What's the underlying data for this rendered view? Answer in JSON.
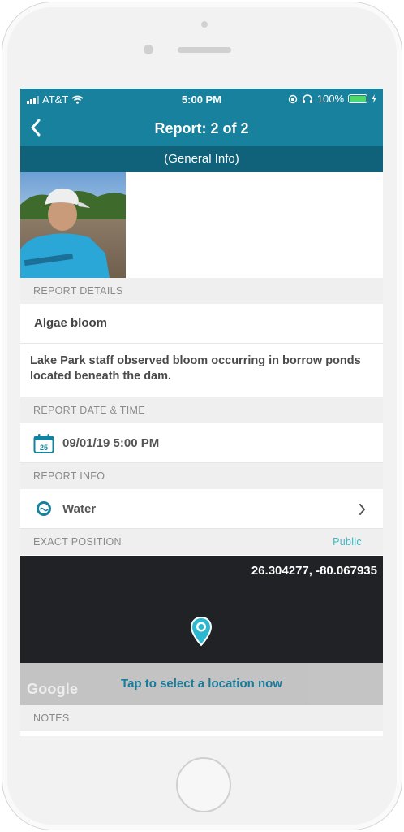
{
  "status": {
    "carrier": "AT&T",
    "time": "5:00 PM",
    "battery": "100%"
  },
  "nav": {
    "title": "Report: 2 of 2",
    "back_icon": "chevron-left-icon"
  },
  "subtitle": "(General Info)",
  "sections": {
    "details_header": "REPORT DETAILS",
    "report_title": "Algae bloom",
    "description": "Lake Park staff observed bloom occurring in borrow ponds located beneath the dam.",
    "datetime_header": "REPORT DATE & TIME",
    "datetime": "09/01/19 5:00 PM",
    "calendar_day": "25",
    "info_header": "REPORT INFO",
    "info_value": "Water",
    "position_header": "EXACT POSITION",
    "position_visibility": "Public",
    "notes_header": "NOTES"
  },
  "map": {
    "coordinates": "26.304277, -80.067935",
    "provider": "Google",
    "tap_prompt": "Tap to select a location now"
  },
  "colors": {
    "header": "#17819e",
    "subheader": "#10617a",
    "accent": "#3cb8c4"
  }
}
